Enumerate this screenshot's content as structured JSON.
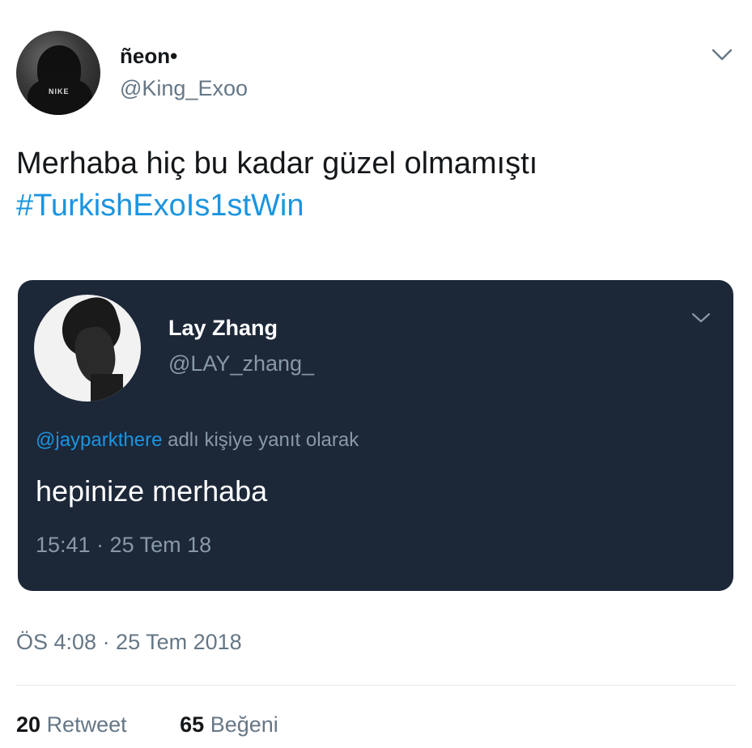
{
  "tweet": {
    "author": {
      "display_name": "ñeon•",
      "handle": "@King_Exoo",
      "avatar_icon": "user-avatar-hoodie"
    },
    "text": "Merhaba hiç bu kadar güzel olmamıştı",
    "hashtag": "#TurkishExoIs1stWin",
    "timestamp": "ÖS 4:08 · 25 Tem 2018",
    "stats": {
      "retweet_count": "20",
      "retweet_label": "Retweet",
      "like_count": "65",
      "like_label": "Beğeni"
    },
    "menu_icon": "chevron-down-icon"
  },
  "quoted_tweet": {
    "author": {
      "display_name": "Lay Zhang",
      "handle": "@LAY_zhang_"
    },
    "reply_to": {
      "mention": "@jayparkthere",
      "suffix": " adlı kişiye yanıt olarak"
    },
    "text": "hepinize merhaba",
    "timestamp": "15:41 · 25 Tem 18"
  },
  "colors": {
    "link": "#1b95e0",
    "secondary_text": "#657786",
    "card_bg": "#1c2738",
    "card_secondary_text": "#8899a6"
  }
}
